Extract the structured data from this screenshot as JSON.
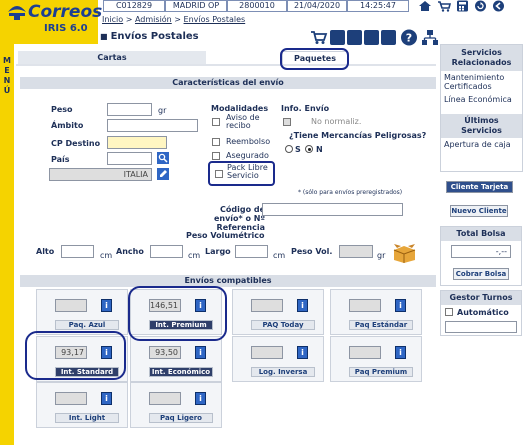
{
  "brand": {
    "name": "Correos",
    "sub": "IRIS 6.0"
  },
  "infobar": {
    "office_code": "C012829",
    "office_name": "MADRID OP",
    "office_num": "2800010",
    "date": "21/04/2020",
    "time": "14:25:47"
  },
  "menu_letters": [
    "M",
    "E",
    "N",
    "Ú"
  ],
  "breadcrumb": {
    "inicio": "Inicio",
    "sep1": " > ",
    "admision": "Admisión",
    "sep2": " > ",
    "envios": "Envíos Postales"
  },
  "page_title": "Envíos Postales",
  "tabs": {
    "cartas": "Cartas",
    "paquetes": "Paquetes"
  },
  "caracteristicas": {
    "header": "Características del envío",
    "peso_label": "Peso",
    "peso_unit": "gr",
    "ambito_label": "Ámbito",
    "cp_label": "CP Destino",
    "pais_label": "País",
    "pais_value": "ITALIA",
    "modalidades_title": "Modalidades",
    "aviso": "Aviso de recibo",
    "reembolso": "Reembolso",
    "asegurado": "Asegurado",
    "pack_libre": "Pack Libre Servicio",
    "info_envio_title": "Info. Envío",
    "no_normaliz": "No normaliz.",
    "mercancias_q": "¿Tiene Mercancías Peligrosas?",
    "radio_s": "S",
    "radio_n": "N",
    "nota_preregistrados": "* (sólo para envíos preregistrados)",
    "codigo_label": "Código de envío* o Nº Referencia",
    "peso_vol_title": "Peso Volumétrico",
    "alto": "Alto",
    "ancho": "Ancho",
    "largo": "Largo",
    "cm": "cm",
    "peso_vol": "Peso Vol.",
    "gr": "gr"
  },
  "compatibles": {
    "header": "Envíos compatibles",
    "products": [
      {
        "label": "Paq. Azul",
        "value": "",
        "selected": false
      },
      {
        "label": "Int. Premium",
        "value": "146,51",
        "selected": true
      },
      {
        "label": "PAQ Today",
        "value": "",
        "selected": false
      },
      {
        "label": "Paq Estándar",
        "value": "",
        "selected": false
      },
      {
        "label": "Int. Standard",
        "value": "93,17",
        "selected": true
      },
      {
        "label": "Int. Económico",
        "value": "93,50",
        "selected": true
      },
      {
        "label": "Log. Inversa",
        "value": "",
        "selected": false
      },
      {
        "label": "Paq Premium",
        "value": "",
        "selected": false
      },
      {
        "label": "Int. Light",
        "value": "",
        "selected": false
      },
      {
        "label": "Paq Ligero",
        "value": "",
        "selected": false
      }
    ]
  },
  "right_panel": {
    "servicios_title": "Servicios Relacionados",
    "link1": "Mantenimiento Certificados",
    "link2": "Línea Económica",
    "ultimos_title": "Últimos Servicios",
    "link3": "Apertura de caja",
    "cliente_tarjeta": "Cliente Tarjeta",
    "nuevo_cliente": "Nuevo Cliente",
    "total_bolsa_title": "Total Bolsa",
    "total_value": "-,--",
    "cobrar_bolsa": "Cobrar Bolsa",
    "gestor_title": "Gestor Turnos",
    "automatico": "Automático"
  },
  "colors": {
    "brand_yellow": "#f5d300",
    "brand_blue": "#1d3f91",
    "annotation_ring": "#1a2a8c"
  }
}
